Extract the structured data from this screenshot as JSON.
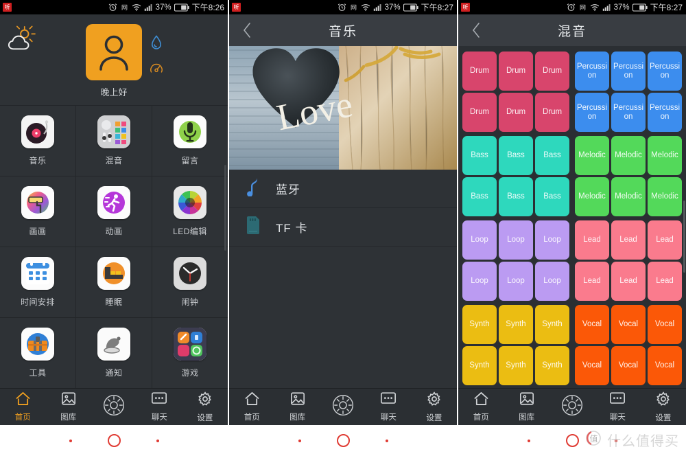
{
  "statusbar": {
    "app_icon_label": "听",
    "icons": [
      "alarm-clock-icon",
      "network-icon",
      "wifi-icon",
      "signal-icon"
    ],
    "battery_percent": "37%",
    "time_panel1": "下午8:26",
    "time_panel2": "下午8:27",
    "time_panel3": "下午8:27"
  },
  "panel1": {
    "greeting": "晚上好",
    "weather_icon": "sun-cloud-icon",
    "avatar_icon": "user-avatar-icon",
    "side_icons": [
      {
        "name": "water-drop-icon",
        "color": "#3f8fd6"
      },
      {
        "name": "gauge-icon",
        "color": "#e08f20"
      }
    ],
    "apps": [
      {
        "label": "音乐",
        "icon": "turntable-icon"
      },
      {
        "label": "混音",
        "icon": "mixer-pads-icon"
      },
      {
        "label": "留言",
        "icon": "microphone-icon"
      },
      {
        "label": "画画",
        "icon": "paint-roller-icon"
      },
      {
        "label": "动画",
        "icon": "running-man-icon"
      },
      {
        "label": "LED编辑",
        "icon": "color-wheel-icon"
      },
      {
        "label": "时间安排",
        "icon": "calendar-icon"
      },
      {
        "label": "睡眠",
        "icon": "bed-icon"
      },
      {
        "label": "闹钟",
        "icon": "clock-icon"
      },
      {
        "label": "工具",
        "icon": "toolbox-icon"
      },
      {
        "label": "通知",
        "icon": "bell-icon"
      },
      {
        "label": "游戏",
        "icon": "game-tiles-icon"
      }
    ],
    "nav": [
      {
        "label": "首页",
        "icon": "home-icon",
        "active": true
      },
      {
        "label": "图库",
        "icon": "gallery-icon",
        "active": false
      },
      {
        "label": "",
        "icon": "brightness-icon",
        "active": false
      },
      {
        "label": "聊天",
        "icon": "chat-dots-icon",
        "active": false
      },
      {
        "label": "设置",
        "icon": "gear-icon",
        "active": false
      }
    ]
  },
  "panel2": {
    "title": "音乐",
    "back_icon": "chevron-left-icon",
    "hero_alt": "love-heart-photo",
    "hero_text": "Love",
    "sources": [
      {
        "label": "蓝牙",
        "icon": "music-note-icon"
      },
      {
        "label": "TF 卡",
        "icon": "sd-card-icon"
      }
    ],
    "nav": [
      {
        "label": "首页",
        "icon": "home-icon",
        "active": false
      },
      {
        "label": "图库",
        "icon": "gallery-icon",
        "active": false
      },
      {
        "label": "",
        "icon": "brightness-icon",
        "active": false
      },
      {
        "label": "聊天",
        "icon": "chat-dots-icon",
        "active": false
      },
      {
        "label": "设置",
        "icon": "gear-icon",
        "active": false
      }
    ]
  },
  "panel3": {
    "title": "混音",
    "back_icon": "chevron-left-icon",
    "pad_groups": [
      {
        "name": "Drum",
        "label": "Drum",
        "color": "#d8456c",
        "count": 6
      },
      {
        "name": "Percussion",
        "label": "Percussion",
        "color": "#3c8dee",
        "count": 6
      },
      {
        "name": "Bass",
        "label": "Bass",
        "color": "#2ed8bd",
        "count": 6
      },
      {
        "name": "Melodic",
        "label": "Melodic",
        "color": "#53d95a",
        "count": 6
      },
      {
        "name": "Loop",
        "label": "Loop",
        "color": "#bb9bf2",
        "count": 6
      },
      {
        "name": "Lead",
        "label": "Lead",
        "color": "#fa7b8d",
        "count": 6
      },
      {
        "name": "Synth",
        "label": "Synth",
        "color": "#ebbd12",
        "count": 6
      },
      {
        "name": "Vocal",
        "label": "Vocal",
        "color": "#fb5807",
        "count": 6
      }
    ],
    "nav": [
      {
        "label": "首页",
        "icon": "home-icon",
        "active": false
      },
      {
        "label": "图库",
        "icon": "gallery-icon",
        "active": false
      },
      {
        "label": "",
        "icon": "brightness-icon",
        "active": false
      },
      {
        "label": "聊天",
        "icon": "chat-dots-icon",
        "active": false
      },
      {
        "label": "设置",
        "icon": "gear-icon",
        "active": false
      }
    ]
  },
  "watermark": {
    "text": "什么值得买",
    "logo_label": "值"
  },
  "colors": {
    "accent": "#f0a020",
    "panel_bg": "#2e3236",
    "appbar_bg": "#393d42",
    "status_bg": "#000000",
    "indicator_red": "#e03b33"
  }
}
